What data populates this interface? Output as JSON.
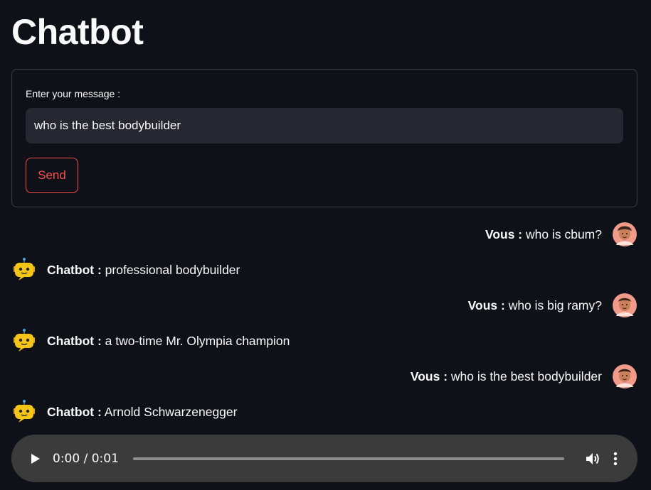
{
  "page": {
    "title": "Chatbot"
  },
  "form": {
    "label": "Enter your message :",
    "input_value": "who is the best bodybuilder",
    "send_label": "Send"
  },
  "messages": [
    {
      "role": "user",
      "speaker": "Vous :",
      "text": " who is cbum?"
    },
    {
      "role": "bot",
      "speaker": "Chatbot :",
      "text": " professional bodybuilder"
    },
    {
      "role": "user",
      "speaker": "Vous :",
      "text": " who is big ramy?"
    },
    {
      "role": "bot",
      "speaker": "Chatbot :",
      "text": " a two-time Mr. Olympia champion"
    },
    {
      "role": "user",
      "speaker": "Vous :",
      "text": " who is the best bodybuilder"
    },
    {
      "role": "bot",
      "speaker": "Chatbot :",
      "text": " Arnold Schwarzenegger"
    }
  ],
  "audio": {
    "time": "0:00 / 0:01",
    "progress": 0
  },
  "colors": {
    "background": "#0e1117",
    "accent": "#ff4b4b",
    "input_bg": "#262730",
    "audio_bg": "#3b3b3b"
  },
  "icons": {
    "user_avatar": "user-avatar-icon",
    "bot_avatar": "robot-avatar-icon",
    "play": "play-icon",
    "volume": "volume-icon",
    "more": "more-vertical-icon"
  }
}
